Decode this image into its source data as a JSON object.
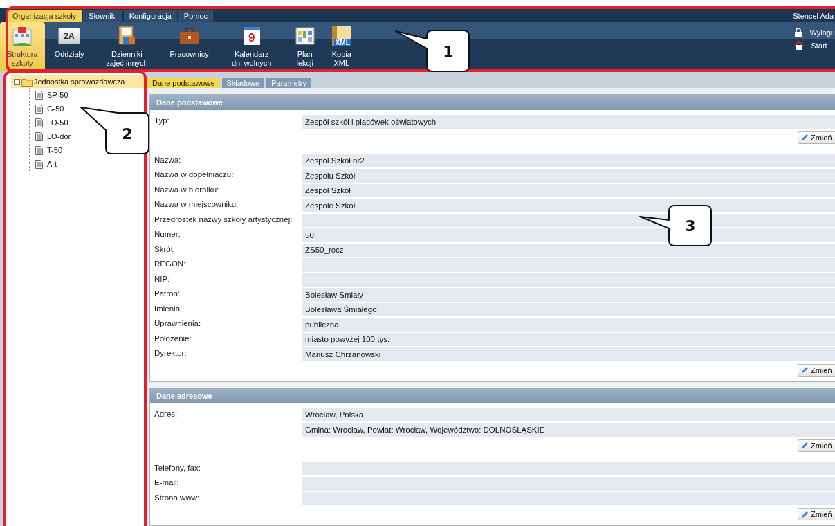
{
  "menu": [
    {
      "label": "Organizacja szkoły",
      "selected": true
    },
    {
      "label": "Słowniki",
      "selected": false
    },
    {
      "label": "Konfiguracja",
      "selected": false
    },
    {
      "label": "Pomoc",
      "selected": false
    }
  ],
  "user": "Stencel Ada",
  "toolbar": [
    {
      "kind": "building",
      "label": "Struktura szkoły",
      "selected": true
    },
    {
      "kind": "class",
      "badge": "2A",
      "label": "Oddziały",
      "selected": false
    },
    {
      "kind": "journal",
      "label": "Dzienniki zajęć innych",
      "selected": false
    },
    {
      "kind": "briefcase",
      "label": "Pracownicy",
      "selected": false
    },
    {
      "kind": "calendar",
      "badge": "9",
      "label": "Kalendarz dni wolnych",
      "selected": false
    },
    {
      "kind": "plan",
      "label": "Plan lekcji",
      "selected": false
    },
    {
      "kind": "xml",
      "badge": "XML",
      "label": "Kopia XML",
      "selected": false
    }
  ],
  "side_links": [
    {
      "kind": "lock",
      "label": "Wylogu"
    },
    {
      "kind": "home",
      "label": "Start"
    }
  ],
  "tree": {
    "label": "Jednostka sprawozdawcza",
    "expanded": true,
    "selected": true,
    "children": [
      {
        "label": "SP-50"
      },
      {
        "label": "G-50"
      },
      {
        "label": "LO-50"
      },
      {
        "label": "LO-dor"
      },
      {
        "label": "T-50"
      },
      {
        "label": "Art"
      }
    ]
  },
  "tabs": [
    {
      "label": "Dane podstawowe",
      "selected": true
    },
    {
      "label": "Składowe",
      "selected": false
    },
    {
      "label": "Parametry",
      "selected": false
    }
  ],
  "sections": [
    {
      "title": "Dane podstawowe",
      "groups": [
        {
          "rows": [
            {
              "label": "Typ:",
              "value": "Zespół szkół i placówek oświatowych"
            }
          ],
          "button": "Zmień"
        },
        {
          "rows": [
            {
              "label": "Nazwa:",
              "value": "Zespół Szkół nr2"
            },
            {
              "label": "Nazwa w dopełniaczu:",
              "value": "Zespołu Szkół"
            },
            {
              "label": "Nazwa w bierniku:",
              "value": "Zespół Szkół"
            },
            {
              "label": "Nazwa w miejscowniku:",
              "value": "Zespole Szkół"
            },
            {
              "label": "Przedrostek nazwy szkoły artystycznej:"
            },
            {
              "label": "Numer:",
              "value": "50"
            },
            {
              "label": "Skrót:",
              "value": "ZS50_rocz"
            },
            {
              "label": "REGON:"
            },
            {
              "label": "NIP:"
            },
            {
              "label": "Patron:",
              "value": "Bolesław Śmiały"
            },
            {
              "label": "Imienia:",
              "value": "Bolesława Śmiałego"
            },
            {
              "label": "Uprawnienia:",
              "value": "publiczna"
            },
            {
              "label": "Położenie:",
              "value": "miasto powyżej 100 tys."
            },
            {
              "label": "Dyrektor:",
              "value": "Mariusz Chrzanowski"
            }
          ],
          "button": "Zmień"
        }
      ]
    },
    {
      "title": "Dane adresowe",
      "groups": [
        {
          "rows": [
            {
              "label": "Adres:",
              "value": "Wrocław, Polska"
            },
            {
              "value": "Gmina: Wrocław, Powiat: Wrocław, Województwo: DOLNOŚLĄSKIE"
            }
          ],
          "button": "Zmień"
        },
        {
          "rows": [
            {
              "label": "Telefony, fax:"
            },
            {
              "label": "E-mail:"
            },
            {
              "label": "Strona www:"
            }
          ],
          "button": "Zmień"
        }
      ]
    }
  ],
  "annotations": [
    {
      "label": "1"
    },
    {
      "label": "2"
    },
    {
      "label": "3"
    }
  ]
}
